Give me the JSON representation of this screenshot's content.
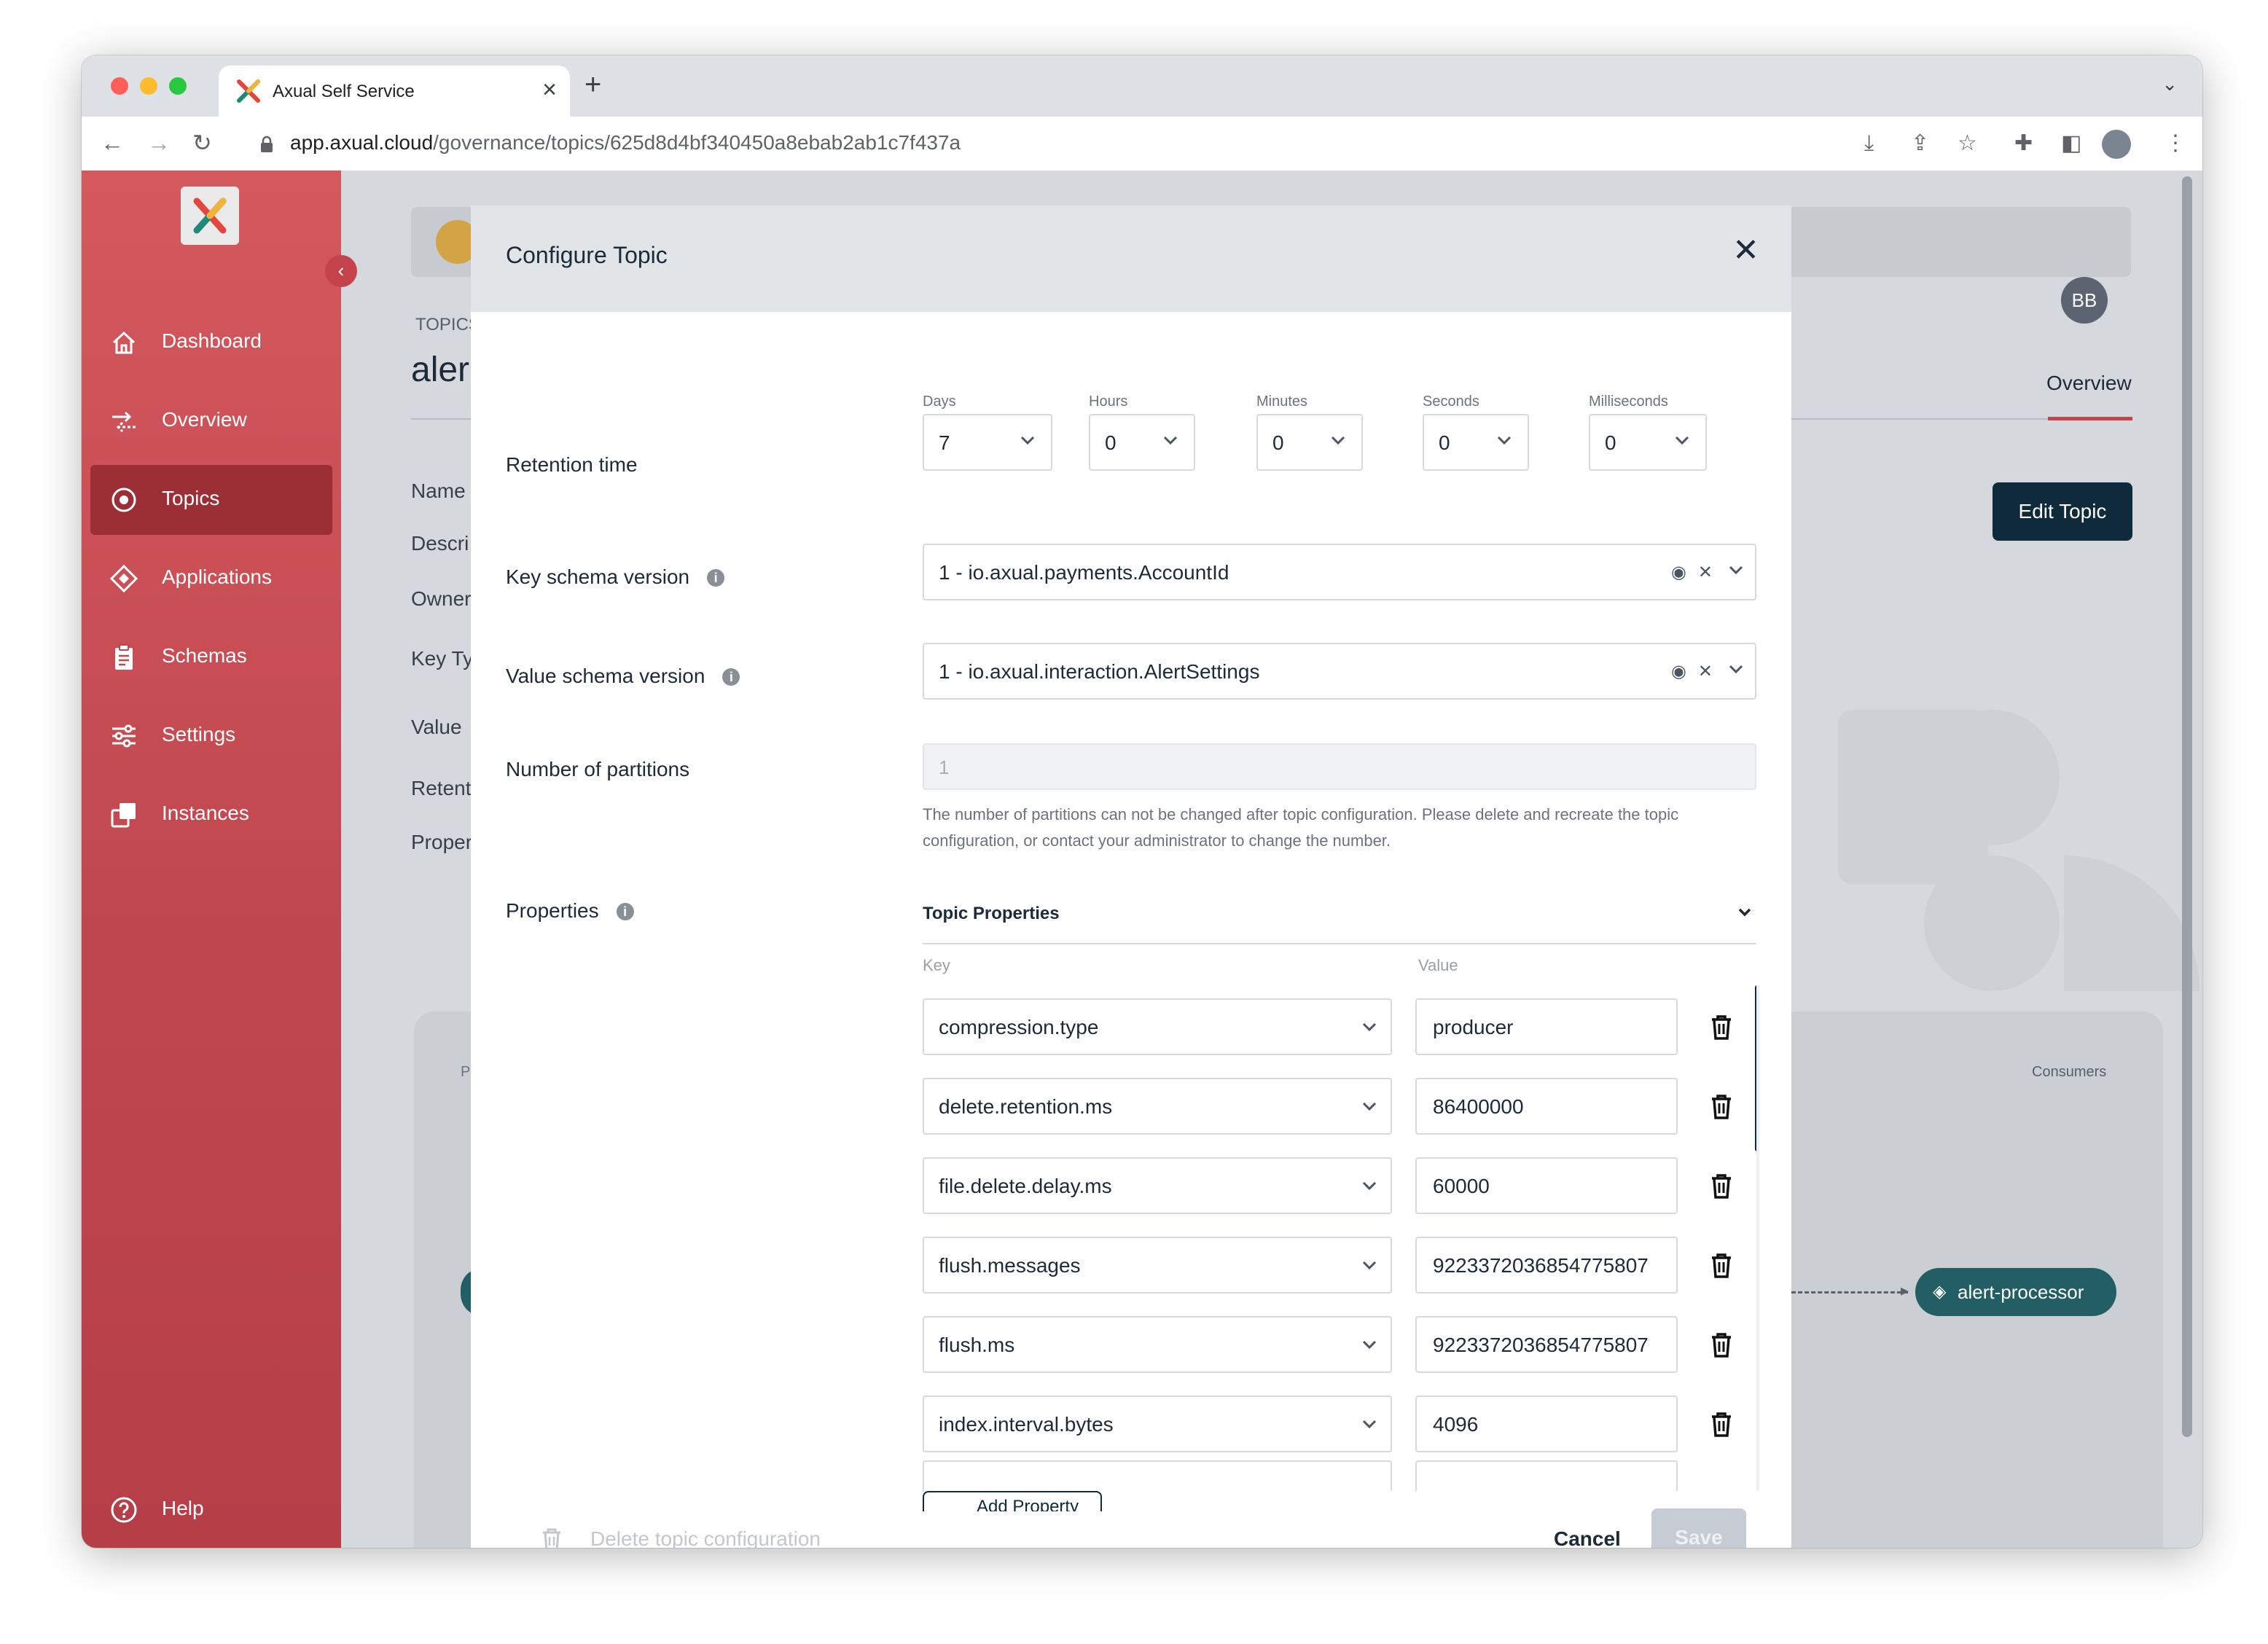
{
  "browser": {
    "tab_title": "Axual Self Service",
    "url_host": "app.axual.cloud",
    "url_path": "/governance/topics/625d8d4bf340450a8ebab2ab1c7f437a"
  },
  "sidebar": {
    "items": [
      {
        "label": "Dashboard",
        "icon": "home-icon"
      },
      {
        "label": "Overview",
        "icon": "flow-icon"
      },
      {
        "label": "Topics",
        "icon": "target-icon",
        "active": true
      },
      {
        "label": "Applications",
        "icon": "diamond-icon"
      },
      {
        "label": "Schemas",
        "icon": "clipboard-icon"
      },
      {
        "label": "Settings",
        "icon": "sliders-icon"
      },
      {
        "label": "Instances",
        "icon": "copy-icon"
      }
    ],
    "help_label": "Help"
  },
  "background": {
    "breadcrumb": "TOPICS",
    "title": "aler",
    "fields": [
      "Name",
      "Descri",
      "Owner",
      "Key Ty",
      "Value",
      "Retent",
      "Proper"
    ],
    "overview_tab": "Overview",
    "edit_topic": "Edit Topic",
    "avatar": "BB",
    "consumers_label": "Consumers",
    "consumer_node": "alert-processor",
    "producers_label": "P"
  },
  "modal": {
    "title": "Configure Topic",
    "retention": {
      "label": "Retention time",
      "units": [
        {
          "label": "Days",
          "value": "7"
        },
        {
          "label": "Hours",
          "value": "0"
        },
        {
          "label": "Minutes",
          "value": "0"
        },
        {
          "label": "Seconds",
          "value": "0"
        },
        {
          "label": "Milliseconds",
          "value": "0"
        }
      ]
    },
    "key_schema": {
      "label": "Key schema version",
      "value": "1 - io.axual.payments.AccountId"
    },
    "value_schema": {
      "label": "Value schema version",
      "value": "1 - io.axual.interaction.AlertSettings"
    },
    "partitions": {
      "label": "Number of partitions",
      "value": "1",
      "help_line1": "The number of partitions can not be changed after topic configuration. Please delete and recreate the topic",
      "help_line2": "configuration, or contact your administrator to change the number."
    },
    "properties": {
      "label": "Properties",
      "section_title": "Topic Properties",
      "key_header": "Key",
      "value_header": "Value",
      "rows": [
        {
          "key": "compression.type",
          "value": "producer"
        },
        {
          "key": "delete.retention.ms",
          "value": "86400000"
        },
        {
          "key": "file.delete.delay.ms",
          "value": "60000"
        },
        {
          "key": "flush.messages",
          "value": "9223372036854775807"
        },
        {
          "key": "flush.ms",
          "value": "9223372036854775807"
        },
        {
          "key": "index.interval.bytes",
          "value": "4096"
        }
      ],
      "add_property": "Add Property"
    },
    "delete_config": "Delete topic configuration",
    "cancel": "Cancel",
    "save": "Save"
  }
}
